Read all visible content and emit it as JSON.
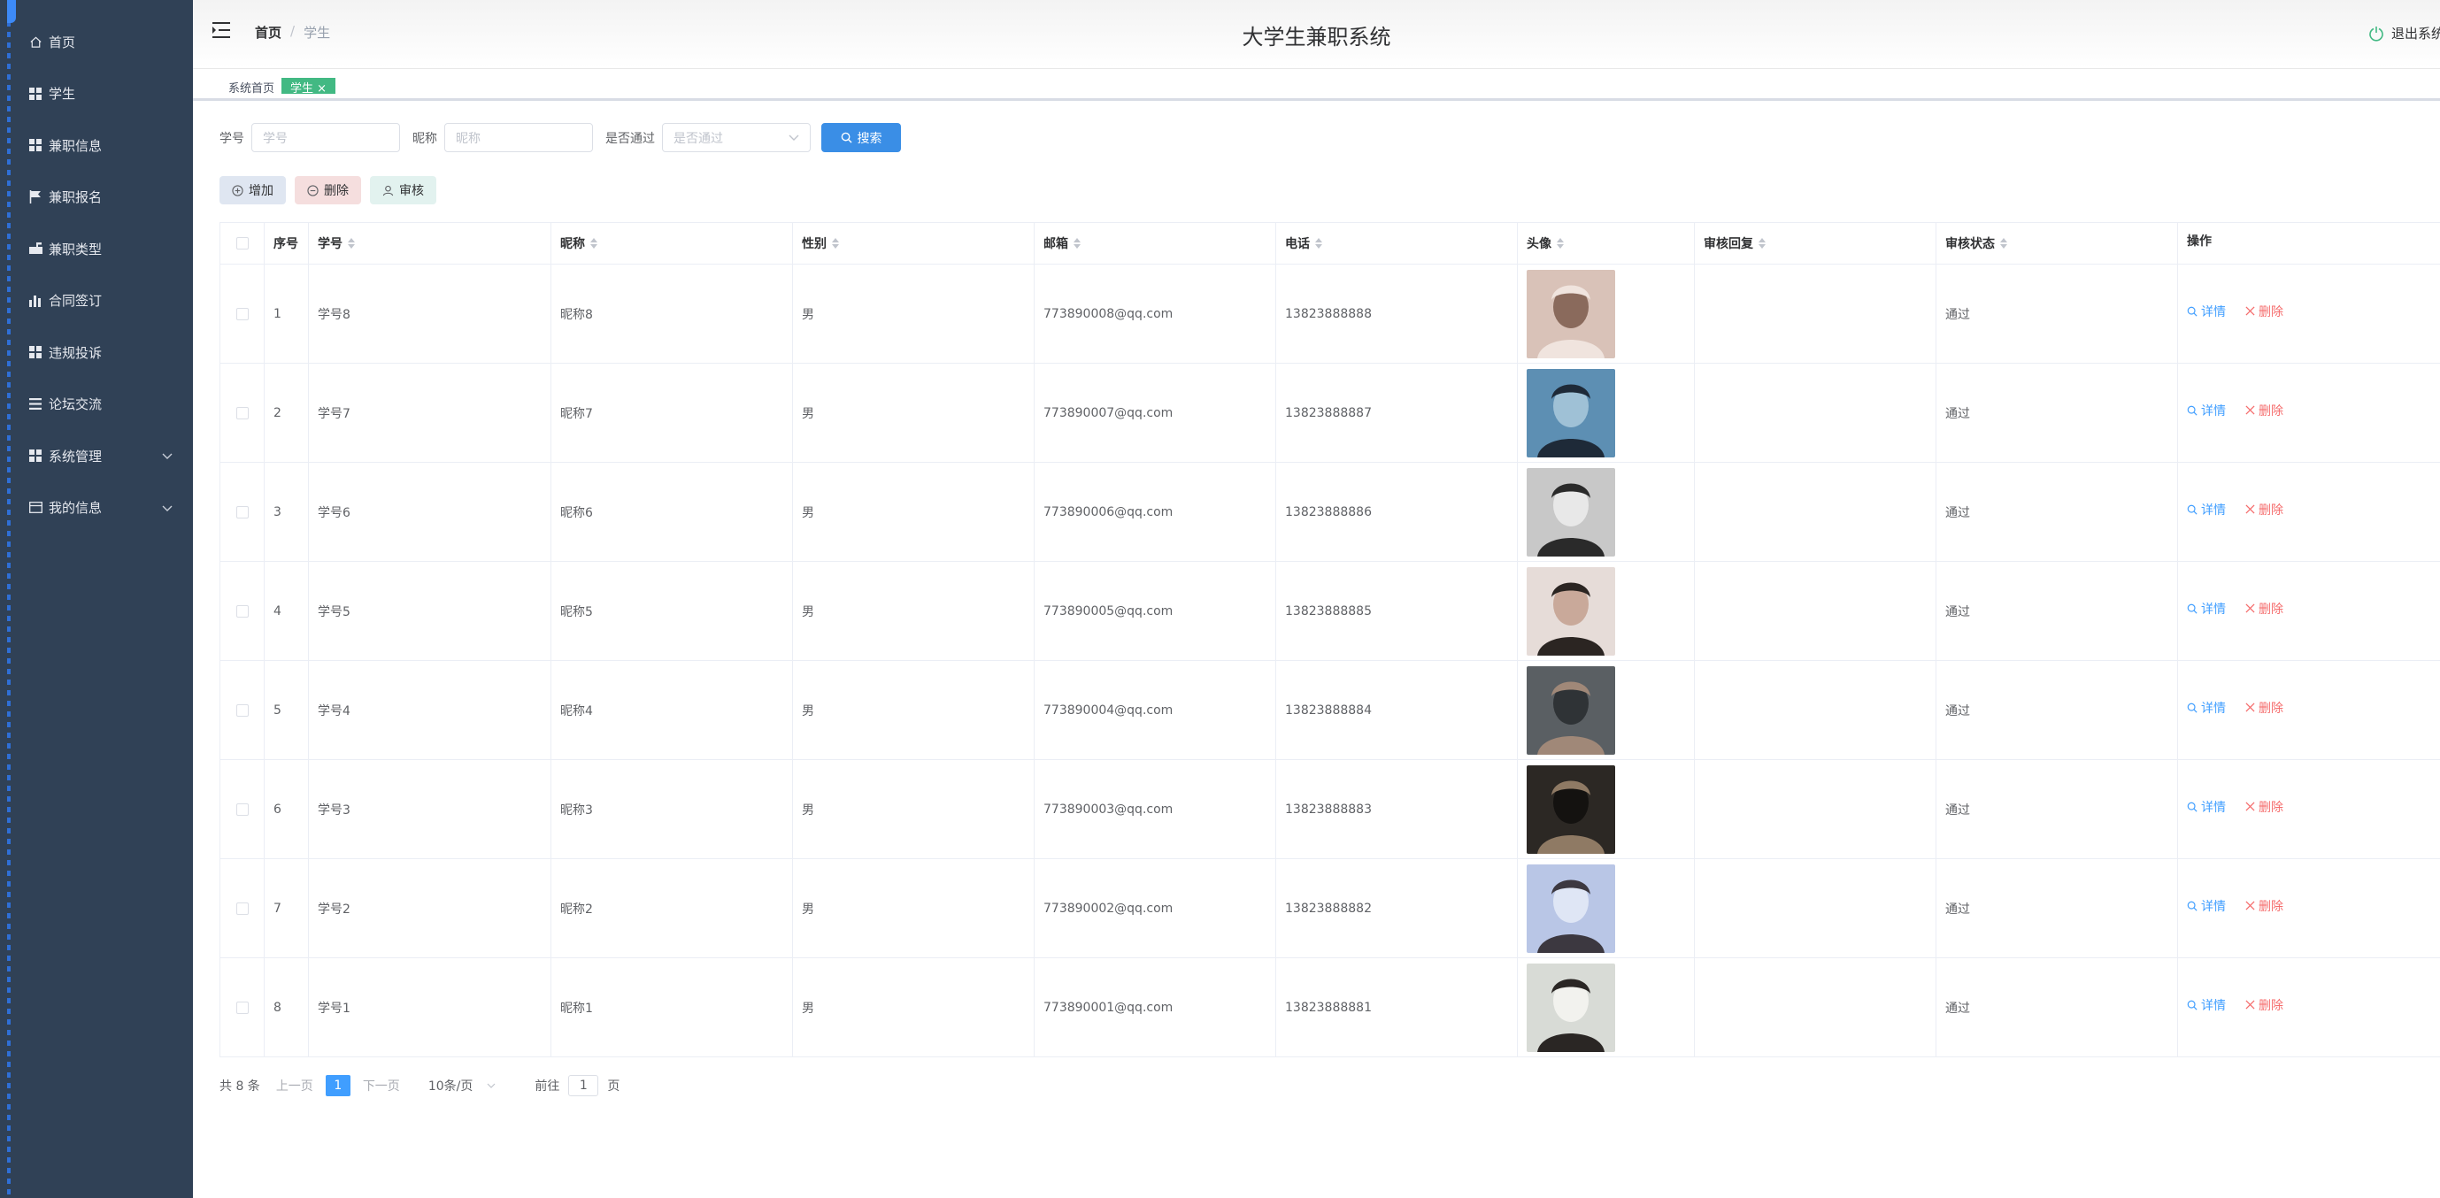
{
  "sidebar": {
    "items": [
      {
        "label": "首页",
        "icon": "home-icon"
      },
      {
        "label": "学生",
        "icon": "grid-icon"
      },
      {
        "label": "兼职信息",
        "icon": "grid-icon"
      },
      {
        "label": "兼职报名",
        "icon": "flag-icon"
      },
      {
        "label": "兼职类型",
        "icon": "mailbox-icon"
      },
      {
        "label": "合同签订",
        "icon": "bar-chart-icon"
      },
      {
        "label": "违规投诉",
        "icon": "grid-icon"
      },
      {
        "label": "论坛交流",
        "icon": "list-icon"
      },
      {
        "label": "系统管理",
        "icon": "grid-icon",
        "has_children": true
      },
      {
        "label": "我的信息",
        "icon": "card-icon",
        "has_children": true
      }
    ]
  },
  "header": {
    "breadcrumb_home": "首页",
    "breadcrumb_sep": "/",
    "breadcrumb_current": "学生",
    "title": "大学生兼职系统",
    "logout_label": "退出系统"
  },
  "tags": {
    "home": "系统首页",
    "active": "学生 ×"
  },
  "search": {
    "sno_label": "学号",
    "sno_placeholder": "学号",
    "nick_label": "昵称",
    "nick_placeholder": "昵称",
    "pass_label": "是否通过",
    "pass_placeholder": "是否通过",
    "button": "搜索"
  },
  "actions": {
    "add": "增加",
    "delete": "删除",
    "audit": "审核"
  },
  "table": {
    "headers": {
      "index": "序号",
      "sno": "学号",
      "nick": "昵称",
      "sex": "性别",
      "email": "邮箱",
      "phone": "电话",
      "avatar": "头像",
      "reply": "审核回复",
      "status": "审核状态",
      "op": "操作"
    },
    "detail_label": "详情",
    "delete_label": "删除",
    "rows": [
      {
        "index": "1",
        "sno": "学号8",
        "nick": "昵称8",
        "sex": "男",
        "email": "773890008@qq.com",
        "phone": "13823888888",
        "reply": "",
        "status": "通过",
        "avatar_colors": [
          "#d9c2b8",
          "#f0e4de",
          "#8a6a5c"
        ]
      },
      {
        "index": "2",
        "sno": "学号7",
        "nick": "昵称7",
        "sex": "男",
        "email": "773890007@qq.com",
        "phone": "13823888887",
        "reply": "",
        "status": "通过",
        "avatar_colors": [
          "#5d8fb3",
          "#1e2a38",
          "#9fc1d6"
        ]
      },
      {
        "index": "3",
        "sno": "学号6",
        "nick": "昵称6",
        "sex": "男",
        "email": "773890006@qq.com",
        "phone": "13823888886",
        "reply": "",
        "status": "通过",
        "avatar_colors": [
          "#c8c8c8",
          "#2a2a2a",
          "#e8e8e8"
        ]
      },
      {
        "index": "4",
        "sno": "学号5",
        "nick": "昵称5",
        "sex": "男",
        "email": "773890005@qq.com",
        "phone": "13823888885",
        "reply": "",
        "status": "通过",
        "avatar_colors": [
          "#e6dcd8",
          "#2b2522",
          "#c9a99a"
        ]
      },
      {
        "index": "5",
        "sno": "学号4",
        "nick": "昵称4",
        "sex": "男",
        "email": "773890004@qq.com",
        "phone": "13823888884",
        "reply": "",
        "status": "通过",
        "avatar_colors": [
          "#5a5f63",
          "#a08878",
          "#2f3336"
        ]
      },
      {
        "index": "6",
        "sno": "学号3",
        "nick": "昵称3",
        "sex": "男",
        "email": "773890003@qq.com",
        "phone": "13823888883",
        "reply": "",
        "status": "通过",
        "avatar_colors": [
          "#2c2824",
          "#8f7a64",
          "#141210"
        ]
      },
      {
        "index": "7",
        "sno": "学号2",
        "nick": "昵称2",
        "sex": "男",
        "email": "773890002@qq.com",
        "phone": "13823888882",
        "reply": "",
        "status": "通过",
        "avatar_colors": [
          "#b9c6e6",
          "#3c3840",
          "#dfe6f5"
        ]
      },
      {
        "index": "8",
        "sno": "学号1",
        "nick": "昵称1",
        "sex": "男",
        "email": "773890001@qq.com",
        "phone": "13823888881",
        "reply": "",
        "status": "通过",
        "avatar_colors": [
          "#d8dbd6",
          "#2a2624",
          "#f2f2ee"
        ]
      }
    ]
  },
  "pagination": {
    "total": "共 8 条",
    "prev": "上一页",
    "current": "1",
    "next": "下一页",
    "page_size": "10条/页",
    "goto_label": "前往",
    "goto_value": "1",
    "goto_suffix": "页"
  },
  "colors": {
    "sidebar_bg": "#304156",
    "primary": "#409eff",
    "danger": "#f56c6c",
    "tag_active": "#42b983"
  }
}
